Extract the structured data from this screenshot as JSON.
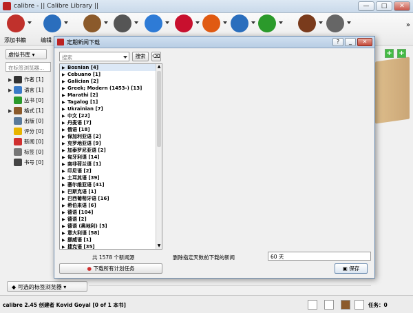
{
  "window": {
    "title": "calibre - || Calibre Library ||",
    "controls": [
      "—",
      "□",
      "✕"
    ]
  },
  "toolbar": {
    "buttons": [
      {
        "label": "添加书籍",
        "icon": "add-book-icon",
        "color": "#c0312c"
      },
      {
        "label": "编辑",
        "icon": "info-icon",
        "color": "#2a6ebd"
      },
      {
        "label": "",
        "icon": "convert-icon",
        "color": "#8b5a2b"
      },
      {
        "label": "",
        "icon": "magnifier-icon",
        "color": "#555555"
      },
      {
        "label": "",
        "icon": "globe-icon",
        "color": "#2e7bd6"
      },
      {
        "label": "",
        "icon": "heart-icon",
        "color": "#c8102e"
      },
      {
        "label": "",
        "icon": "news-icon",
        "color": "#e05a12"
      },
      {
        "label": "",
        "icon": "help-icon",
        "color": "#2a6ebd"
      },
      {
        "label": "",
        "icon": "recycle-icon",
        "color": "#2b9a2b"
      },
      {
        "label": "",
        "icon": "library-icon",
        "color": "#7a3b1c"
      },
      {
        "label": "",
        "icon": "device-icon",
        "color": "#666666"
      }
    ],
    "more": "»"
  },
  "sidebar": {
    "virtual_library": "虚拟书库",
    "tag_search_placeholder": "在标签浏览器...",
    "items": [
      {
        "label": "作者 [1]",
        "expand": "▶",
        "icon": "author-icon",
        "color": "#333333"
      },
      {
        "label": "语言 [1]",
        "expand": "▶",
        "icon": "language-icon",
        "color": "#3a7bc8"
      },
      {
        "label": "丛书 [0]",
        "expand": "",
        "icon": "series-icon",
        "color": "#2b9a2b"
      },
      {
        "label": "格式 [1]",
        "expand": "▶",
        "icon": "format-icon",
        "color": "#8b5a2b"
      },
      {
        "label": "出版 [0]",
        "expand": "",
        "icon": "publisher-icon",
        "color": "#5a7a9a"
      },
      {
        "label": "评分 [0]",
        "expand": "",
        "icon": "rating-icon",
        "color": "#e8b400"
      },
      {
        "label": "新闻 [0]",
        "expand": "",
        "icon": "news-pin-icon",
        "color": "#d03030"
      },
      {
        "label": "标签 [0]",
        "expand": "",
        "icon": "tag-icon",
        "color": "#777777"
      },
      {
        "label": "书号 [0]",
        "expand": "",
        "icon": "isbn-icon",
        "color": "#444444"
      }
    ],
    "tag_browser_button": "可选的标签浏览器"
  },
  "dialog": {
    "title": "定期新闻下载",
    "controls": [
      "?",
      "_",
      "✕"
    ],
    "search_placeholder": "搜索",
    "search_button": "搜索",
    "clear_button": "⌫",
    "languages": [
      "Bosnian [4]",
      "Cebuano [1]",
      "Galician [2]",
      "Greek; Modern (1453-) [13]",
      "Marathi [2]",
      "Tagalog [1]",
      "Ukrainian [7]",
      "中文 [22]",
      "丹麦语 [7]",
      "俄语 [18]",
      "保加利亚语 [2]",
      "克罗地亚语 [9]",
      "加泰罗尼亚语 [2]",
      "匈牙利语 [14]",
      "南非荷兰语 [1]",
      "印尼语 [2]",
      "土耳其语 [39]",
      "塞尔维亚语 [41]",
      "巴斯克语 [1]",
      "巴西葡萄牙语 [16]",
      "希伯来语 [6]",
      "德语 [104]",
      "德语 [2]",
      "德语 (奥地利) [3]",
      "意大利语 [58]",
      "挪威语 [1]",
      "捷克语 [35]"
    ],
    "summary": "共 1578 个新闻源",
    "download_all": "下载所有计划任务",
    "delete_label": "删除指定天数前下载的新闻",
    "days_value": "60 天",
    "save_button": "保存"
  },
  "status": {
    "text": "calibre 2.45 创建者 Kovid Goyal  [0 of 1 本书]",
    "jobs": "任务：0"
  }
}
